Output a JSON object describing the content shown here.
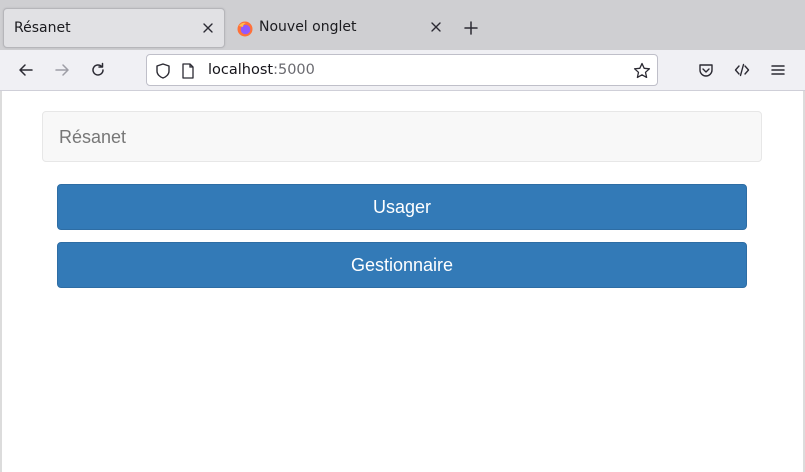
{
  "browser": {
    "tabs": [
      {
        "title": "Résanet",
        "active": true
      },
      {
        "title": "Nouvel onglet",
        "active": false
      }
    ],
    "url": {
      "host": "localhost",
      "port": ":5000"
    }
  },
  "page": {
    "brand": "Résanet",
    "buttons": {
      "usager": "Usager",
      "gestionnaire": "Gestionnaire"
    }
  },
  "colors": {
    "primary": "#337ab7",
    "primary_border": "#2e6da4",
    "navbar_bg": "#f8f8f8",
    "brand_text": "#777777"
  }
}
